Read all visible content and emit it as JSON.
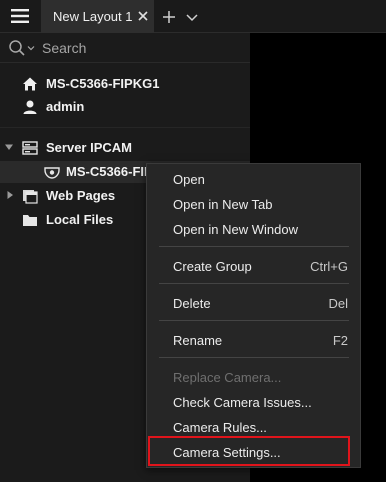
{
  "tab": {
    "title": "New Layout 1"
  },
  "search": {
    "placeholder": "Search"
  },
  "tree": {
    "system": "MS-C5366-FIPKG1",
    "user": "admin",
    "server": "Server IPCAM",
    "camera": "MS-C5366-FIP",
    "web_pages": "Web Pages",
    "local_files": "Local Files"
  },
  "context_menu": {
    "open": "Open",
    "open_new_tab": "Open in New Tab",
    "open_new_window": "Open in New Window",
    "create_group": "Create Group",
    "create_group_shortcut": "Ctrl+G",
    "delete": "Delete",
    "delete_shortcut": "Del",
    "rename": "Rename",
    "rename_shortcut": "F2",
    "replace_camera": "Replace Camera...",
    "check_camera_issues": "Check Camera Issues...",
    "camera_rules": "Camera Rules...",
    "camera_settings": "Camera Settings..."
  },
  "colors": {
    "highlight": "#e0141b",
    "menu_bg": "#262626",
    "panel_bg": "#1b1b1b"
  },
  "icons": [
    "hamburger-menu-icon",
    "close-icon",
    "plus-icon",
    "chevron-down-icon",
    "search-icon",
    "home-icon",
    "user-icon",
    "server-icon",
    "camera-icon",
    "web-pages-icon",
    "folder-icon",
    "expand-arrow-icon"
  ]
}
